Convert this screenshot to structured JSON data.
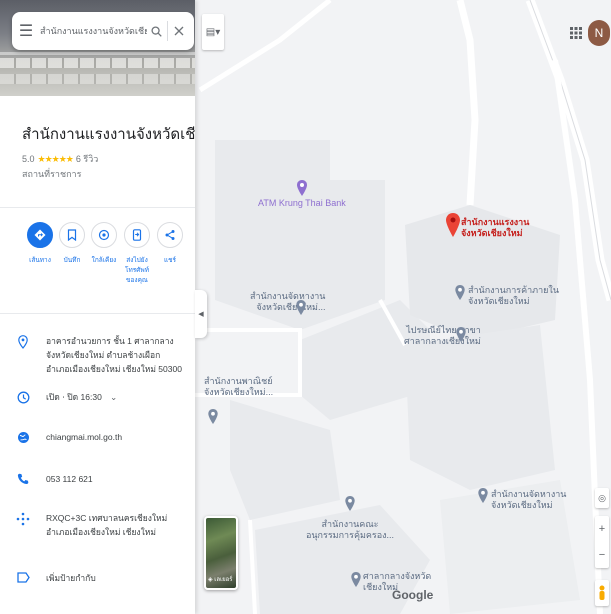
{
  "search": {
    "query": "สำนักงานแรงงานจังหวัดเชียงใหม่"
  },
  "place": {
    "title": "สำนักงานแรงงานจังหวัดเชียงใหม่",
    "rating": "5.0",
    "stars": "★★★★★",
    "reviews": "6 รีวิว",
    "category": "สถานที่ราชการ"
  },
  "actions": [
    {
      "label": "เส้นทาง"
    },
    {
      "label": "บันทึก"
    },
    {
      "label": "ใกล้เคียง"
    },
    {
      "label": "ส่งไปยังโทรศัพท์ของคุณ"
    },
    {
      "label": "แชร์"
    }
  ],
  "info": {
    "address": "อาคารอำนวยการ ชั้น 1 ศาลากลางจังหวัดเชียงใหม่ ตำบลช้างเผือก อำเภอเมืองเชียงใหม่ เชียงใหม่ 50300",
    "hours": "เปิด ⋅ ปิด 16:30",
    "website": "chiangmai.mol.go.th",
    "phone": "053 112 621",
    "plus_code": "RXQC+3C เทศบาลนครเชียงใหม่ อำเภอเมืองเชียงใหม่ เชียงใหม่",
    "add_label": "เพิ่มป้ายกำกับ"
  },
  "map": {
    "layers_label": "เลเยอร์",
    "brand": "Google",
    "avatar_letter": "N",
    "pois": {
      "atm": "ATM Krung Thai Bank",
      "selected_l1": "สำนักงานแรงงาน",
      "selected_l2": "จังหวัดเชียงใหม่",
      "provincial_l1": "สำนักงานจัดหางาน",
      "provincial_l2": "จังหวัดเชียงใหม่...",
      "commerce_l1": "สำนักงานการค้าภายใน",
      "commerce_l2": "จังหวัดเชียงใหม่",
      "post_l1": "ไปรษณีย์ไทย สาขา",
      "post_l2": "ศาลากลางเชียงใหม่",
      "dev_l1": "สำนักงานพาณิชย์",
      "dev_l2": "จังหวัดเชียงใหม่...",
      "employ_l1": "สำนักงานจัดหางาน",
      "employ_l2": "จังหวัดเชียงใหม่",
      "committee_l1": "สำนักงานคณะ",
      "committee_l2": "อนุกรรมการคุ้มครอง...",
      "hall_l1": "ศาลากลางจังหวัด",
      "hall_l2": "เชียงใหม่"
    }
  },
  "colors": {
    "accent": "#1a73e8",
    "marker": "#ea4335",
    "avatar": "#8d5a44",
    "star": "#fbbc04"
  }
}
